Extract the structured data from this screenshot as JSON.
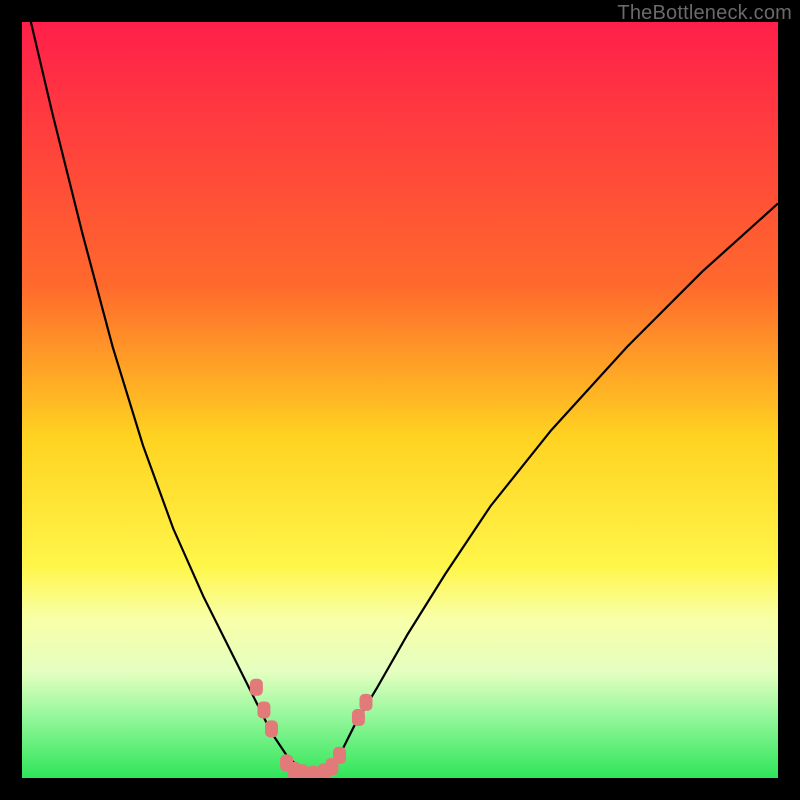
{
  "watermark": "TheBottleneck.com",
  "colors": {
    "background": "#000000",
    "curve_stroke": "#000000",
    "marker_fill": "#e27a7a",
    "band_green": "#2fe559"
  },
  "chart_data": {
    "type": "line",
    "title": "",
    "xlabel": "",
    "ylabel": "",
    "xlim": [
      0,
      100
    ],
    "ylim": [
      0,
      100
    ],
    "gradient_stops": [
      {
        "offset": 0,
        "color": "#ff1f4a"
      },
      {
        "offset": 35,
        "color": "#ff6a2c"
      },
      {
        "offset": 55,
        "color": "#ffd321"
      },
      {
        "offset": 72,
        "color": "#fff64a"
      },
      {
        "offset": 79,
        "color": "#f8ffa8"
      },
      {
        "offset": 86,
        "color": "#e4ffc0"
      },
      {
        "offset": 92,
        "color": "#93f79a"
      },
      {
        "offset": 100,
        "color": "#2fe559"
      }
    ],
    "series": [
      {
        "name": "bottleneck-curve",
        "x": [
          0,
          4,
          8,
          12,
          16,
          20,
          24,
          28,
          31,
          33,
          35,
          37,
          38.5,
          40,
          42,
          44,
          47,
          51,
          56,
          62,
          70,
          80,
          90,
          100
        ],
        "y": [
          105,
          88,
          72,
          57,
          44,
          33,
          24,
          16,
          10,
          6,
          3,
          1,
          0.5,
          1,
          3,
          7,
          12,
          19,
          27,
          36,
          46,
          57,
          67,
          76
        ]
      }
    ],
    "markers": [
      {
        "x": 31.0,
        "y": 12.0
      },
      {
        "x": 32.0,
        "y": 9.0
      },
      {
        "x": 33.0,
        "y": 6.5
      },
      {
        "x": 35.0,
        "y": 2.0
      },
      {
        "x": 36.0,
        "y": 1.0
      },
      {
        "x": 37.0,
        "y": 0.7
      },
      {
        "x": 38.5,
        "y": 0.5
      },
      {
        "x": 40.0,
        "y": 0.8
      },
      {
        "x": 41.0,
        "y": 1.5
      },
      {
        "x": 42.0,
        "y": 3.0
      },
      {
        "x": 44.5,
        "y": 8.0
      },
      {
        "x": 45.5,
        "y": 10.0
      }
    ]
  }
}
